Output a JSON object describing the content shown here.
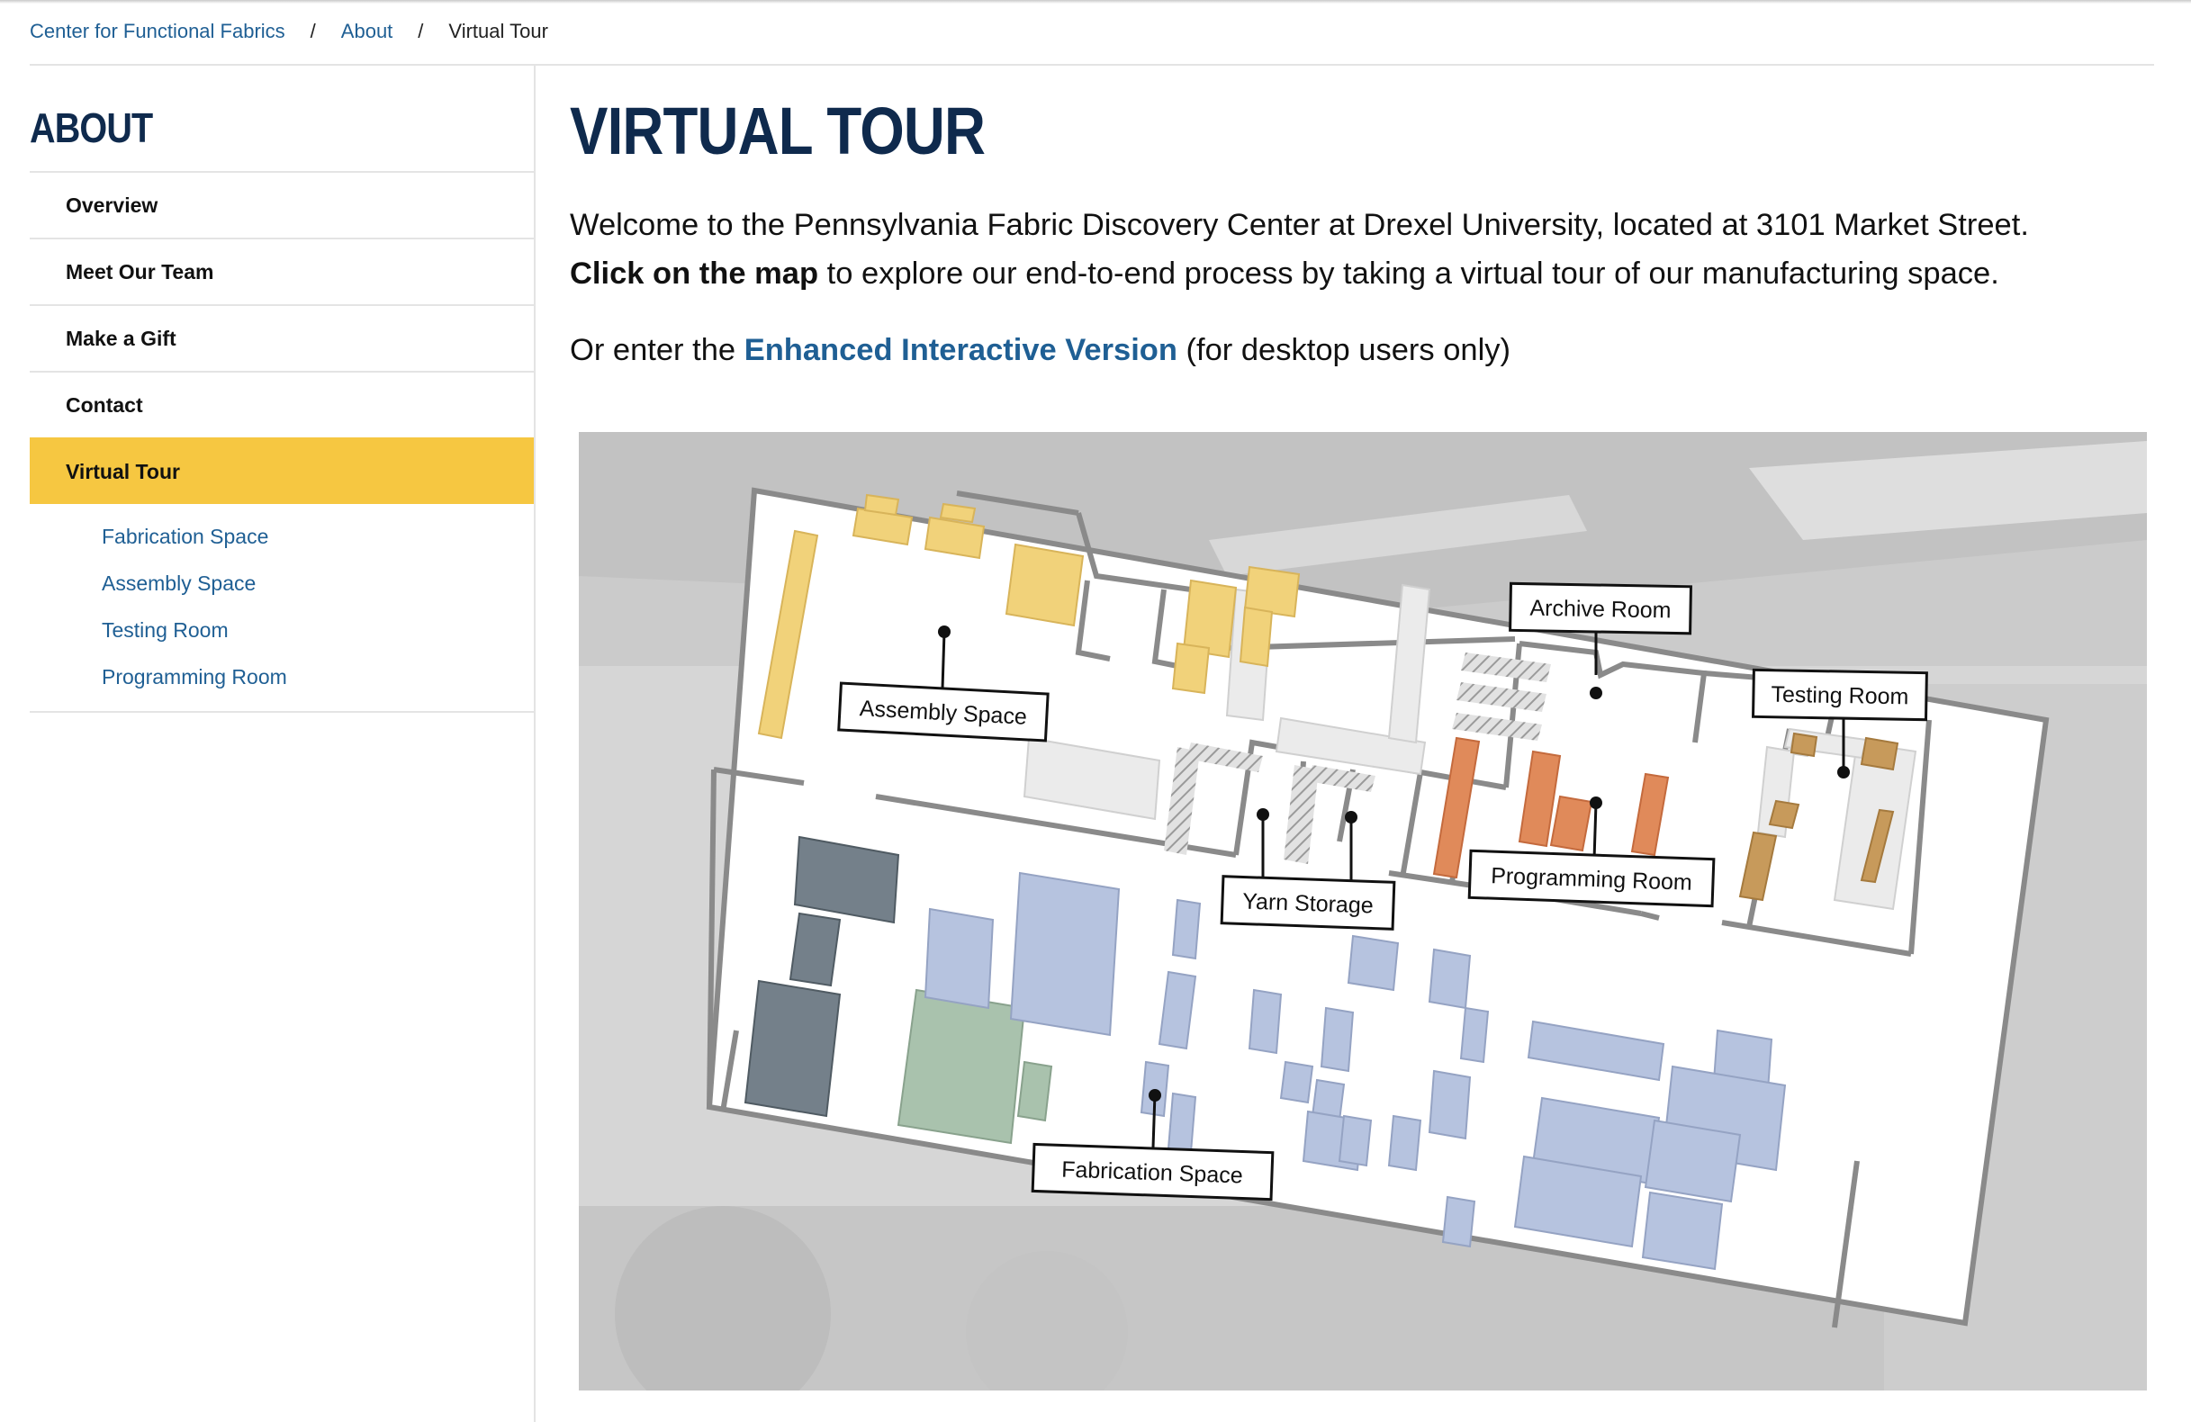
{
  "breadcrumb": {
    "items": [
      "Center for Functional Fabrics",
      "About"
    ],
    "current": "Virtual Tour",
    "separator": "/"
  },
  "sidebar": {
    "title": "ABOUT",
    "items": [
      {
        "label": "Overview"
      },
      {
        "label": "Meet Our Team"
      },
      {
        "label": "Make a Gift"
      },
      {
        "label": "Contact"
      },
      {
        "label": "Virtual Tour",
        "active": true
      }
    ],
    "subitems": [
      {
        "label": "Fabrication Space"
      },
      {
        "label": "Assembly Space"
      },
      {
        "label": "Testing Room"
      },
      {
        "label": "Programming Room"
      }
    ]
  },
  "main": {
    "title": "VIRTUAL TOUR",
    "intro_text": "Welcome to the Pennsylvania Fabric Discovery Center at Drexel University, located at 3101 Market Street.",
    "intro_bold": "Click on the map",
    "intro_rest": " to explore our end-to-end process by taking a virtual tour of our manufacturing space.",
    "enhanced_prefix": "Or enter the ",
    "enhanced_link": "Enhanced Interactive Version",
    "enhanced_suffix": " (for desktop users only)"
  },
  "map": {
    "labels": {
      "assembly": "Assembly Space",
      "archive": "Archive Room",
      "testing": "Testing Room",
      "yarn": "Yarn Storage",
      "programming": "Programming Room",
      "fabrication": "Fabrication Space"
    }
  },
  "colors": {
    "navy": "#0f2a4d",
    "link": "#1f5f94",
    "active_nav": "#f6c741",
    "assembly_fill": "#f1d27a",
    "programming_fill": "#e08a5a",
    "testing_fill": "#c79a5b",
    "fabrication_fill": "#b6c3df"
  }
}
